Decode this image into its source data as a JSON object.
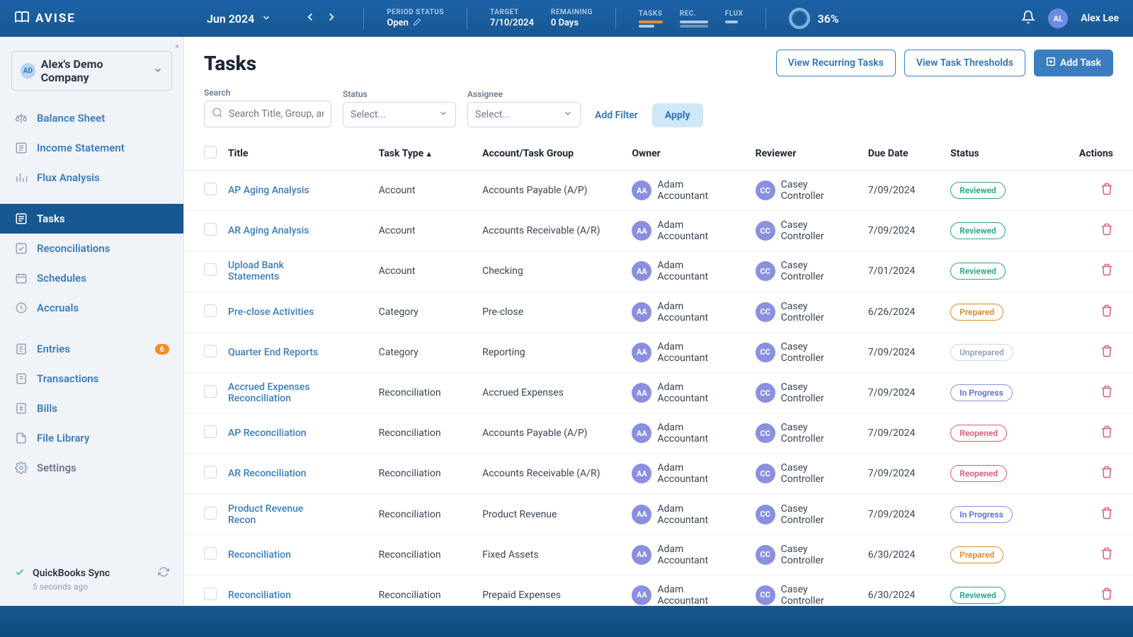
{
  "brand": "AVISE",
  "period": {
    "label": "Jun 2024"
  },
  "periodStatus": {
    "label": "PERIOD STATUS",
    "value": "Open"
  },
  "target": {
    "label": "TARGET",
    "value": "7/10/2024"
  },
  "remaining": {
    "label": "REMAINING",
    "value": "0 Days"
  },
  "mini": {
    "tasks": "TASKS",
    "rec": "REC.",
    "flux": "FLUX"
  },
  "progress": {
    "pct": "36%"
  },
  "user": {
    "initials": "AL",
    "name": "Alex Lee"
  },
  "company": {
    "badge": "AD",
    "name": "Alex's Demo Company"
  },
  "nav": [
    {
      "key": "balance-sheet",
      "label": "Balance Sheet"
    },
    {
      "key": "income-statement",
      "label": "Income Statement"
    },
    {
      "key": "flux-analysis",
      "label": "Flux Analysis"
    },
    {
      "key": "tasks",
      "label": "Tasks",
      "active": true
    },
    {
      "key": "reconciliations",
      "label": "Reconciliations"
    },
    {
      "key": "schedules",
      "label": "Schedules"
    },
    {
      "key": "accruals",
      "label": "Accruals"
    },
    {
      "key": "entries",
      "label": "Entries",
      "badge": "6"
    },
    {
      "key": "transactions",
      "label": "Transactions"
    },
    {
      "key": "bills",
      "label": "Bills"
    },
    {
      "key": "file-library",
      "label": "File Library"
    },
    {
      "key": "settings",
      "label": "Settings",
      "muted": true
    }
  ],
  "sync": {
    "label": "QuickBooks Sync",
    "sub": "5 seconds ago"
  },
  "page": {
    "title": "Tasks",
    "recurring": "View Recurring Tasks",
    "thresholds": "View Task Thresholds",
    "addTask": "Add Task"
  },
  "filters": {
    "searchLabel": "Search",
    "searchPlaceholder": "Search Title, Group, and",
    "statusLabel": "Status",
    "statusPlaceholder": "Select...",
    "assigneeLabel": "Assignee",
    "assigneePlaceholder": "Select...",
    "addFilter": "Add Filter",
    "apply": "Apply"
  },
  "columns": {
    "title": "Title",
    "taskType": "Task Type",
    "account": "Account/Task Group",
    "owner": "Owner",
    "reviewer": "Reviewer",
    "due": "Due Date",
    "status": "Status",
    "actions": "Actions"
  },
  "tasks": [
    {
      "title": "AP Aging Analysis",
      "type": "Account",
      "group": "Accounts Payable (A/P)",
      "owner": "Adam Accountant",
      "oi": "AA",
      "reviewer": "Casey Controller",
      "ri": "CC",
      "due": "7/09/2024",
      "status": "Reviewed",
      "pill": "pill-reviewed"
    },
    {
      "title": "AR Aging Analysis",
      "type": "Account",
      "group": "Accounts Receivable (A/R)",
      "owner": "Adam Accountant",
      "oi": "AA",
      "reviewer": "Casey Controller",
      "ri": "CC",
      "due": "7/09/2024",
      "status": "Reviewed",
      "pill": "pill-reviewed"
    },
    {
      "title": "Upload Bank Statements",
      "type": "Account",
      "group": "Checking",
      "owner": "Adam Accountant",
      "oi": "AA",
      "reviewer": "Casey Controller",
      "ri": "CC",
      "due": "7/01/2024",
      "status": "Reviewed",
      "pill": "pill-reviewed"
    },
    {
      "title": "Pre-close Activities",
      "type": "Category",
      "group": "Pre-close",
      "owner": "Adam Accountant",
      "oi": "AA",
      "reviewer": "Casey Controller",
      "ri": "CC",
      "due": "6/26/2024",
      "status": "Prepared",
      "pill": "pill-prepared"
    },
    {
      "title": "Quarter End Reports",
      "type": "Category",
      "group": "Reporting",
      "owner": "Adam Accountant",
      "oi": "AA",
      "reviewer": "Casey Controller",
      "ri": "CC",
      "due": "7/09/2024",
      "status": "Unprepared",
      "pill": "pill-unprepared"
    },
    {
      "title": "Accrued Expenses Reconciliation",
      "type": "Reconciliation",
      "group": "Accrued Expenses",
      "owner": "Adam Accountant",
      "oi": "AA",
      "reviewer": "Casey Controller",
      "ri": "CC",
      "due": "7/09/2024",
      "status": "In Progress",
      "pill": "pill-inprogress"
    },
    {
      "title": "AP Reconciliation",
      "type": "Reconciliation",
      "group": "Accounts Payable (A/P)",
      "owner": "Adam Accountant",
      "oi": "AA",
      "reviewer": "Casey Controller",
      "ri": "CC",
      "due": "7/09/2024",
      "status": "Reopened",
      "pill": "pill-reopened"
    },
    {
      "title": "AR Reconciliation",
      "type": "Reconciliation",
      "group": "Accounts Receivable (A/R)",
      "owner": "Adam Accountant",
      "oi": "AA",
      "reviewer": "Casey Controller",
      "ri": "CC",
      "due": "7/09/2024",
      "status": "Reopened",
      "pill": "pill-reopened"
    },
    {
      "title": "Product Revenue Recon",
      "type": "Reconciliation",
      "group": "Product Revenue",
      "owner": "Adam Accountant",
      "oi": "AA",
      "reviewer": "Casey Controller",
      "ri": "CC",
      "due": "7/09/2024",
      "status": "In Progress",
      "pill": "pill-inprogress"
    },
    {
      "title": "Reconciliation",
      "type": "Reconciliation",
      "group": "Fixed Assets",
      "owner": "Adam Accountant",
      "oi": "AA",
      "reviewer": "Casey Controller",
      "ri": "CC",
      "due": "6/30/2024",
      "status": "Prepared",
      "pill": "pill-prepared"
    },
    {
      "title": "Reconciliation",
      "type": "Reconciliation",
      "group": "Prepaid Expenses",
      "owner": "Adam Accountant",
      "oi": "AA",
      "reviewer": "Casey Controller",
      "ri": "CC",
      "due": "6/30/2024",
      "status": "Reviewed",
      "pill": "pill-reviewed"
    }
  ]
}
